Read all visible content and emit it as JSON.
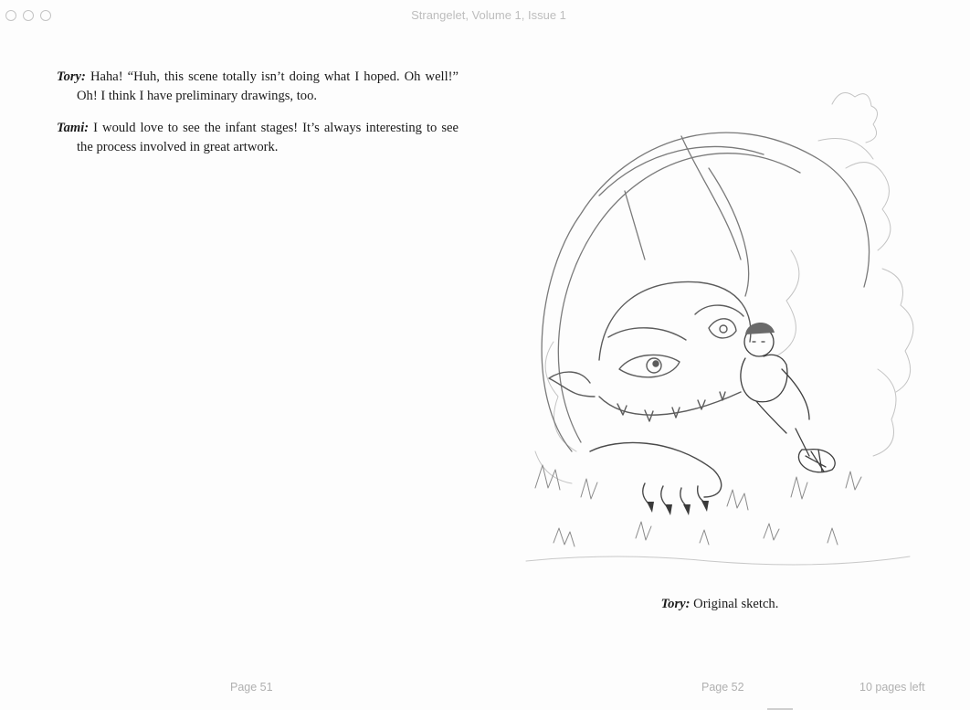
{
  "window": {
    "title": "Strangelet, Volume 1, Issue 1",
    "controls": [
      "close-icon",
      "minimize-icon",
      "zoom-icon"
    ]
  },
  "left_page": {
    "paragraphs": [
      {
        "speaker": "Tory:",
        "text": "Haha! “Huh, this scene totally isn’t doing what I hoped. Oh well!” Oh! I think I have preliminary drawings, too."
      },
      {
        "speaker": "Tami:",
        "text": "I would love to see the infant stages! It’s always interesting to see the process involved in great artwork."
      }
    ],
    "page_number": "Page 51"
  },
  "right_page": {
    "figure_icon": "pencil-sketch-illustration",
    "caption_speaker": "Tory:",
    "caption_text": "Original sketch.",
    "page_number": "Page 52"
  },
  "footer": {
    "pages_left": "10 pages left"
  }
}
